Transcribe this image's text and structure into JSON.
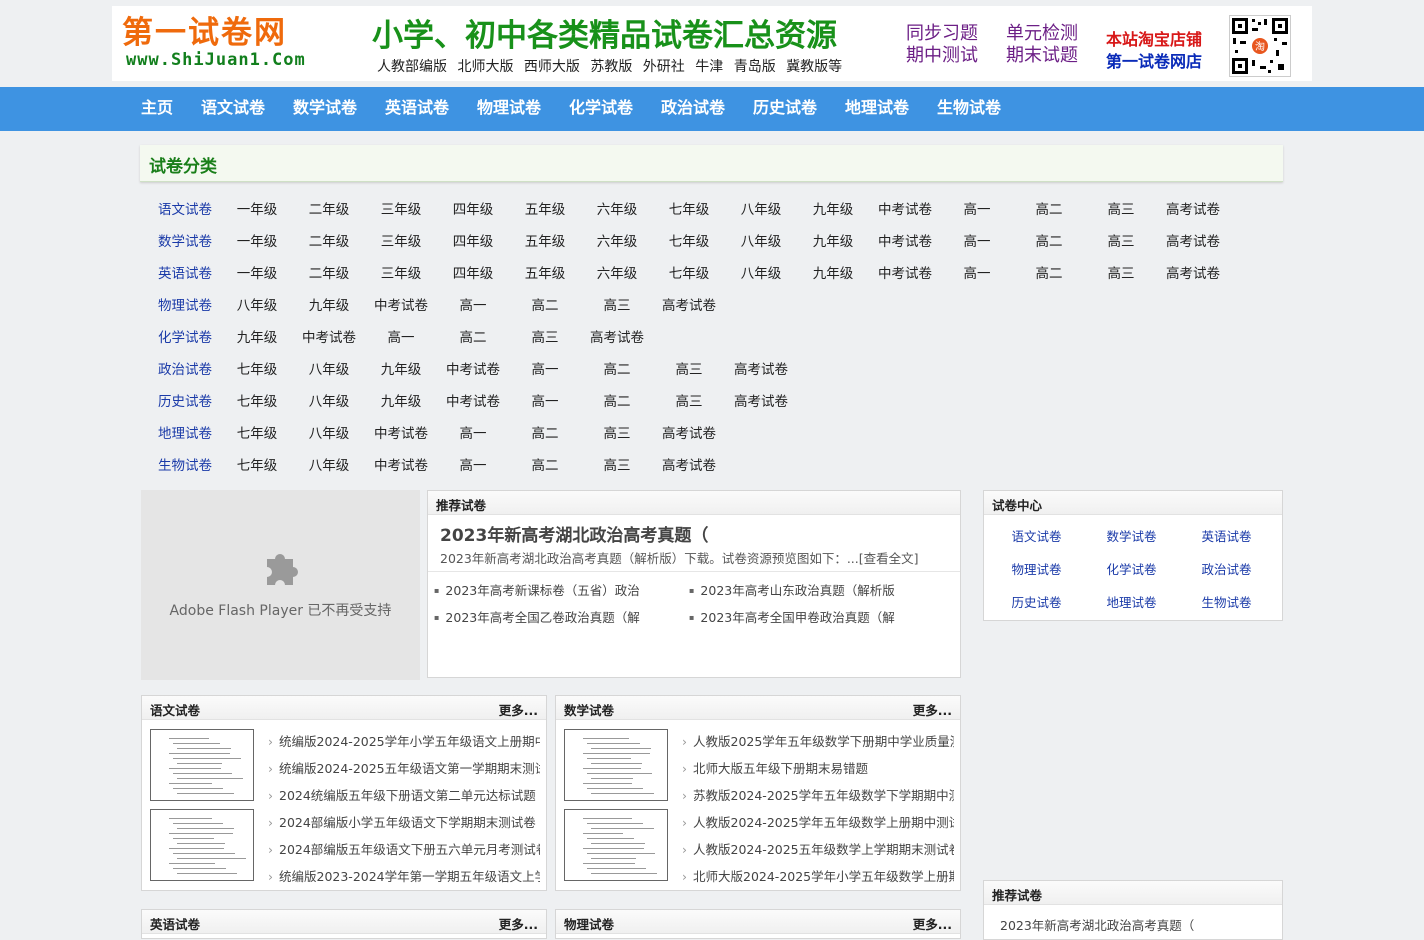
{
  "header": {
    "logo_main": "第一试卷网",
    "logo_url": "www.ShiJuan1.Com",
    "slogan": "小学、初中各类精品试卷汇总资源",
    "editions": "人教部编版 北师大版 西师大版 苏教版 外研社 牛津 青岛版 冀教版等",
    "keywords": [
      "同步习题",
      "单元检测",
      "期中测试",
      "期末试题"
    ],
    "taobao_line1": "本站淘宝店铺",
    "taobao_line2": "第一试卷网店",
    "qr_label": "淘"
  },
  "nav": [
    "主页",
    "语文试卷",
    "数学试卷",
    "英语试卷",
    "物理试卷",
    "化学试卷",
    "政治试卷",
    "历史试卷",
    "地理试卷",
    "生物试卷"
  ],
  "categories": {
    "title": "试卷分类",
    "rows": [
      [
        "语文试卷",
        "一年级",
        "二年级",
        "三年级",
        "四年级",
        "五年级",
        "六年级",
        "七年级",
        "八年级",
        "九年级",
        "中考试卷",
        "高一",
        "高二",
        "高三",
        "高考试卷"
      ],
      [
        "数学试卷",
        "一年级",
        "二年级",
        "三年级",
        "四年级",
        "五年级",
        "六年级",
        "七年级",
        "八年级",
        "九年级",
        "中考试卷",
        "高一",
        "高二",
        "高三",
        "高考试卷"
      ],
      [
        "英语试卷",
        "一年级",
        "二年级",
        "三年级",
        "四年级",
        "五年级",
        "六年级",
        "七年级",
        "八年级",
        "九年级",
        "中考试卷",
        "高一",
        "高二",
        "高三",
        "高考试卷"
      ],
      [
        "物理试卷",
        "八年级",
        "九年级",
        "中考试卷",
        "高一",
        "高二",
        "高三",
        "高考试卷"
      ],
      [
        "化学试卷",
        "九年级",
        "中考试卷",
        "高一",
        "高二",
        "高三",
        "高考试卷"
      ],
      [
        "政治试卷",
        "七年级",
        "八年级",
        "九年级",
        "中考试卷",
        "高一",
        "高二",
        "高三",
        "高考试卷"
      ],
      [
        "历史试卷",
        "七年级",
        "八年级",
        "九年级",
        "中考试卷",
        "高一",
        "高二",
        "高三",
        "高考试卷"
      ],
      [
        "地理试卷",
        "七年级",
        "八年级",
        "中考试卷",
        "高一",
        "高二",
        "高三",
        "高考试卷"
      ],
      [
        "生物试卷",
        "七年级",
        "八年级",
        "中考试卷",
        "高一",
        "高二",
        "高三",
        "高考试卷"
      ]
    ]
  },
  "flash": {
    "text": "Adobe Flash Player 已不再受支持"
  },
  "recommend": {
    "header": "推荐试卷",
    "title": "2023年新高考湖北政治高考真题（",
    "desc": "2023年新高考湖北政治高考真题（解析版）下载。试卷资源预览图如下：...[查看全文]",
    "items": [
      "2023年高考新课标卷（五省）政治",
      "2023年高考山东政治真题（解析版",
      "2023年高考全国乙卷政治真题（解",
      "2023年高考全国甲卷政治真题（解"
    ]
  },
  "center": {
    "header": "试卷中心",
    "items": [
      "语文试卷",
      "数学试卷",
      "英语试卷",
      "物理试卷",
      "化学试卷",
      "政治试卷",
      "历史试卷",
      "地理试卷",
      "生物试卷"
    ]
  },
  "chinese_box": {
    "header": "语文试卷",
    "more": "更多...",
    "items": [
      "统编版2024-2025学年小学五年级语文上册期中",
      "统编版2024-2025五年级语文第一学期期末测试",
      "2024统编版五年级下册语文第二单元达标试题",
      "2024部编版小学五年级语文下学期期末测试卷",
      "2024部编版五年级语文下册五六单元月考测试卷",
      "统编版2023-2024学年第一学期五年级语文上学"
    ]
  },
  "math_box": {
    "header": "数学试卷",
    "more": "更多...",
    "items": [
      "人教版2025学年五年级数学下册期中学业质量测",
      "北师大版五年级下册期末易错题",
      "苏教版2024-2025学年五年级数学下学期期中测",
      "人教版2024-2025学年五年级数学上册期中测试",
      "人教版2024-2025五年级数学上学期期末测试卷",
      "北师大版2024-2025学年小学五年级数学上册期"
    ]
  },
  "english_box": {
    "header": "英语试卷",
    "more": "更多..."
  },
  "physics_box": {
    "header": "物理试卷",
    "more": "更多..."
  },
  "right_recommend": {
    "header": "推荐试卷",
    "item": "2023年新高考湖北政治高考真题（"
  }
}
